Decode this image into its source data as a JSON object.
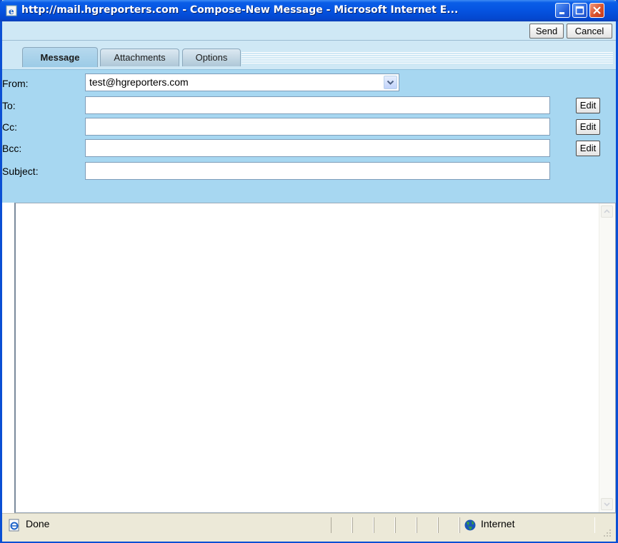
{
  "window": {
    "title": "http://mail.hgreporters.com - Compose-New Message - Microsoft Internet E..."
  },
  "toolbar": {
    "send_label": "Send",
    "cancel_label": "Cancel"
  },
  "tabs": [
    {
      "label": "Message",
      "active": true
    },
    {
      "label": "Attachments",
      "active": false
    },
    {
      "label": "Options",
      "active": false
    }
  ],
  "form": {
    "from_label": "From:",
    "from_value": "test@hgreporters.com",
    "to_label": "To:",
    "to_value": "",
    "cc_label": "Cc:",
    "cc_value": "",
    "bcc_label": "Bcc:",
    "bcc_value": "",
    "subject_label": "Subject:",
    "subject_value": "",
    "edit_label": "Edit"
  },
  "status": {
    "left_text": "Done",
    "zone_text": "Internet"
  },
  "colors": {
    "title_bar": "#0553e0",
    "form_background": "#a7d7f1",
    "toolbar_background": "#cfe8f5"
  }
}
